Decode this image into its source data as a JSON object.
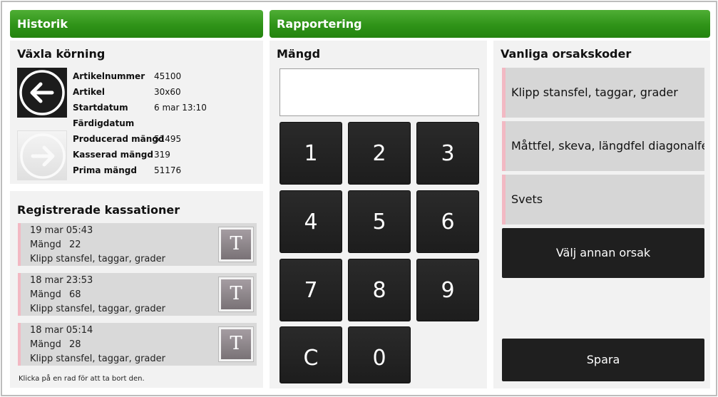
{
  "historik": {
    "title": "Historik",
    "switch_run": {
      "heading": "Växla körning",
      "prev_icon": "arrow-left-circle-icon",
      "next_icon": "arrow-right-circle-icon",
      "fields": [
        {
          "key": "Artikelnummer",
          "value": "45100"
        },
        {
          "key": "Artikel",
          "value": "30x60"
        },
        {
          "key": "Startdatum",
          "value": "6 mar 13:10"
        },
        {
          "key": "Färdigdatum",
          "value": ""
        },
        {
          "key": "Producerad mängd",
          "value": "51495"
        },
        {
          "key": "Kasserad mängd",
          "value": "319"
        },
        {
          "key": "Prima mängd",
          "value": "51176"
        }
      ]
    },
    "kassationer": {
      "heading": "Registrerade kassationer",
      "rows": [
        {
          "date": "19 mar 05:43",
          "qty_label": "Mängd",
          "qty": "22",
          "reason": "Klipp stansfel, taggar, grader",
          "button": "T"
        },
        {
          "date": "18 mar 23:53",
          "qty_label": "Mängd",
          "qty": "68",
          "reason": "Klipp stansfel, taggar, grader",
          "button": "T"
        },
        {
          "date": "18 mar 05:14",
          "qty_label": "Mängd",
          "qty": "28",
          "reason": "Klipp stansfel, taggar, grader",
          "button": "T"
        }
      ],
      "hint": "Klicka på en rad för att ta bort den."
    }
  },
  "rapportering": {
    "title": "Rapportering",
    "mangd": {
      "heading": "Mängd",
      "value": "",
      "keys": [
        "1",
        "2",
        "3",
        "4",
        "5",
        "6",
        "7",
        "8",
        "9",
        "C",
        "0"
      ]
    },
    "orsaker": {
      "heading": "Vanliga orsakskoder",
      "items": [
        "Klipp stansfel, taggar, grader",
        "Måttfel, skeva, längdfel diagonalfel.",
        "Svets"
      ],
      "other_button": "Välj annan orsak",
      "save_button": "Spara"
    }
  },
  "colors": {
    "header_green": "#2f9318",
    "accent_pink": "#f2b9c3",
    "key_dark": "#1f1f1f"
  }
}
